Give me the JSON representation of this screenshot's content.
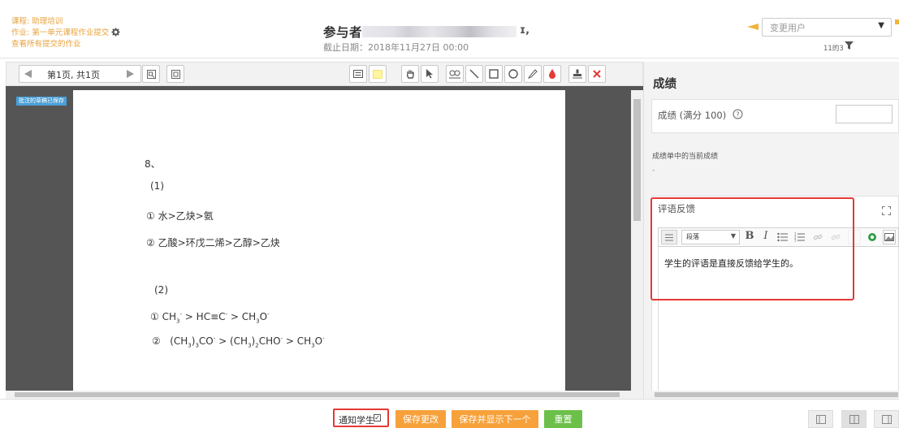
{
  "header": {
    "course_link": "课程: 助理培训",
    "assignment_link": "作业: 第一单元课程作业提交",
    "all_submissions_link": "查看所有提交的作业",
    "participant_title": "参与者",
    "participant_name_trail": "ɪ,",
    "deadline": "截止日期：2018年11月27日 00:00",
    "change_user_placeholder": "变更用户",
    "count": "11的3"
  },
  "toolbar": {
    "page_label": "第1页, 共1页"
  },
  "document": {
    "annotation_badge": "批注的草稿已保存",
    "lines": {
      "q8": "8、",
      "p1": "(1)",
      "l1_num": "①",
      "l1_text": "水>乙炔>氨",
      "l2_num": "②",
      "l2_text": "乙酸>环戊二烯>乙醇>乙炔",
      "p2": "(2)",
      "l3_num": "①",
      "l4_num": "②"
    }
  },
  "grade_panel": {
    "heading": "成绩",
    "grade_label": "成绩 (满分 100)",
    "grade_value": "",
    "current_grade_label": "成绩单中的当前成绩",
    "current_grade_value": "-",
    "feedback_label": "评语反馈",
    "editor_format": "段落",
    "feedback_text": "学生的评语是直接反馈给学生的。"
  },
  "footer": {
    "notify_label": "通知学生",
    "save_label": "保存更改",
    "save_next_label": "保存并显示下一个",
    "reset_label": "重置"
  },
  "colors": {
    "accent_orange": "#f7a13b",
    "link_orange": "#e8a33d",
    "reset_green": "#6cc04a",
    "highlight_red": "#e53935",
    "badge_blue": "#4ba0d8"
  },
  "icons": [
    "gear-icon",
    "back-arrow-icon",
    "chevron-down-icon",
    "filter-icon",
    "prev-page-icon",
    "next-page-icon",
    "search-page-icon",
    "rotate-page-icon",
    "comment-icon",
    "highlight-color-icon",
    "hand-icon",
    "select-arrow-icon",
    "oval-icon",
    "line-icon",
    "rectangle-icon",
    "circle-icon",
    "pen-icon",
    "color-drop-icon",
    "stamp-icon",
    "delete-icon",
    "help-icon",
    "expand-icon",
    "bold-icon",
    "italic-icon",
    "bullet-list-icon",
    "numbered-list-icon",
    "link-icon",
    "unlink-icon",
    "image-icon"
  ]
}
